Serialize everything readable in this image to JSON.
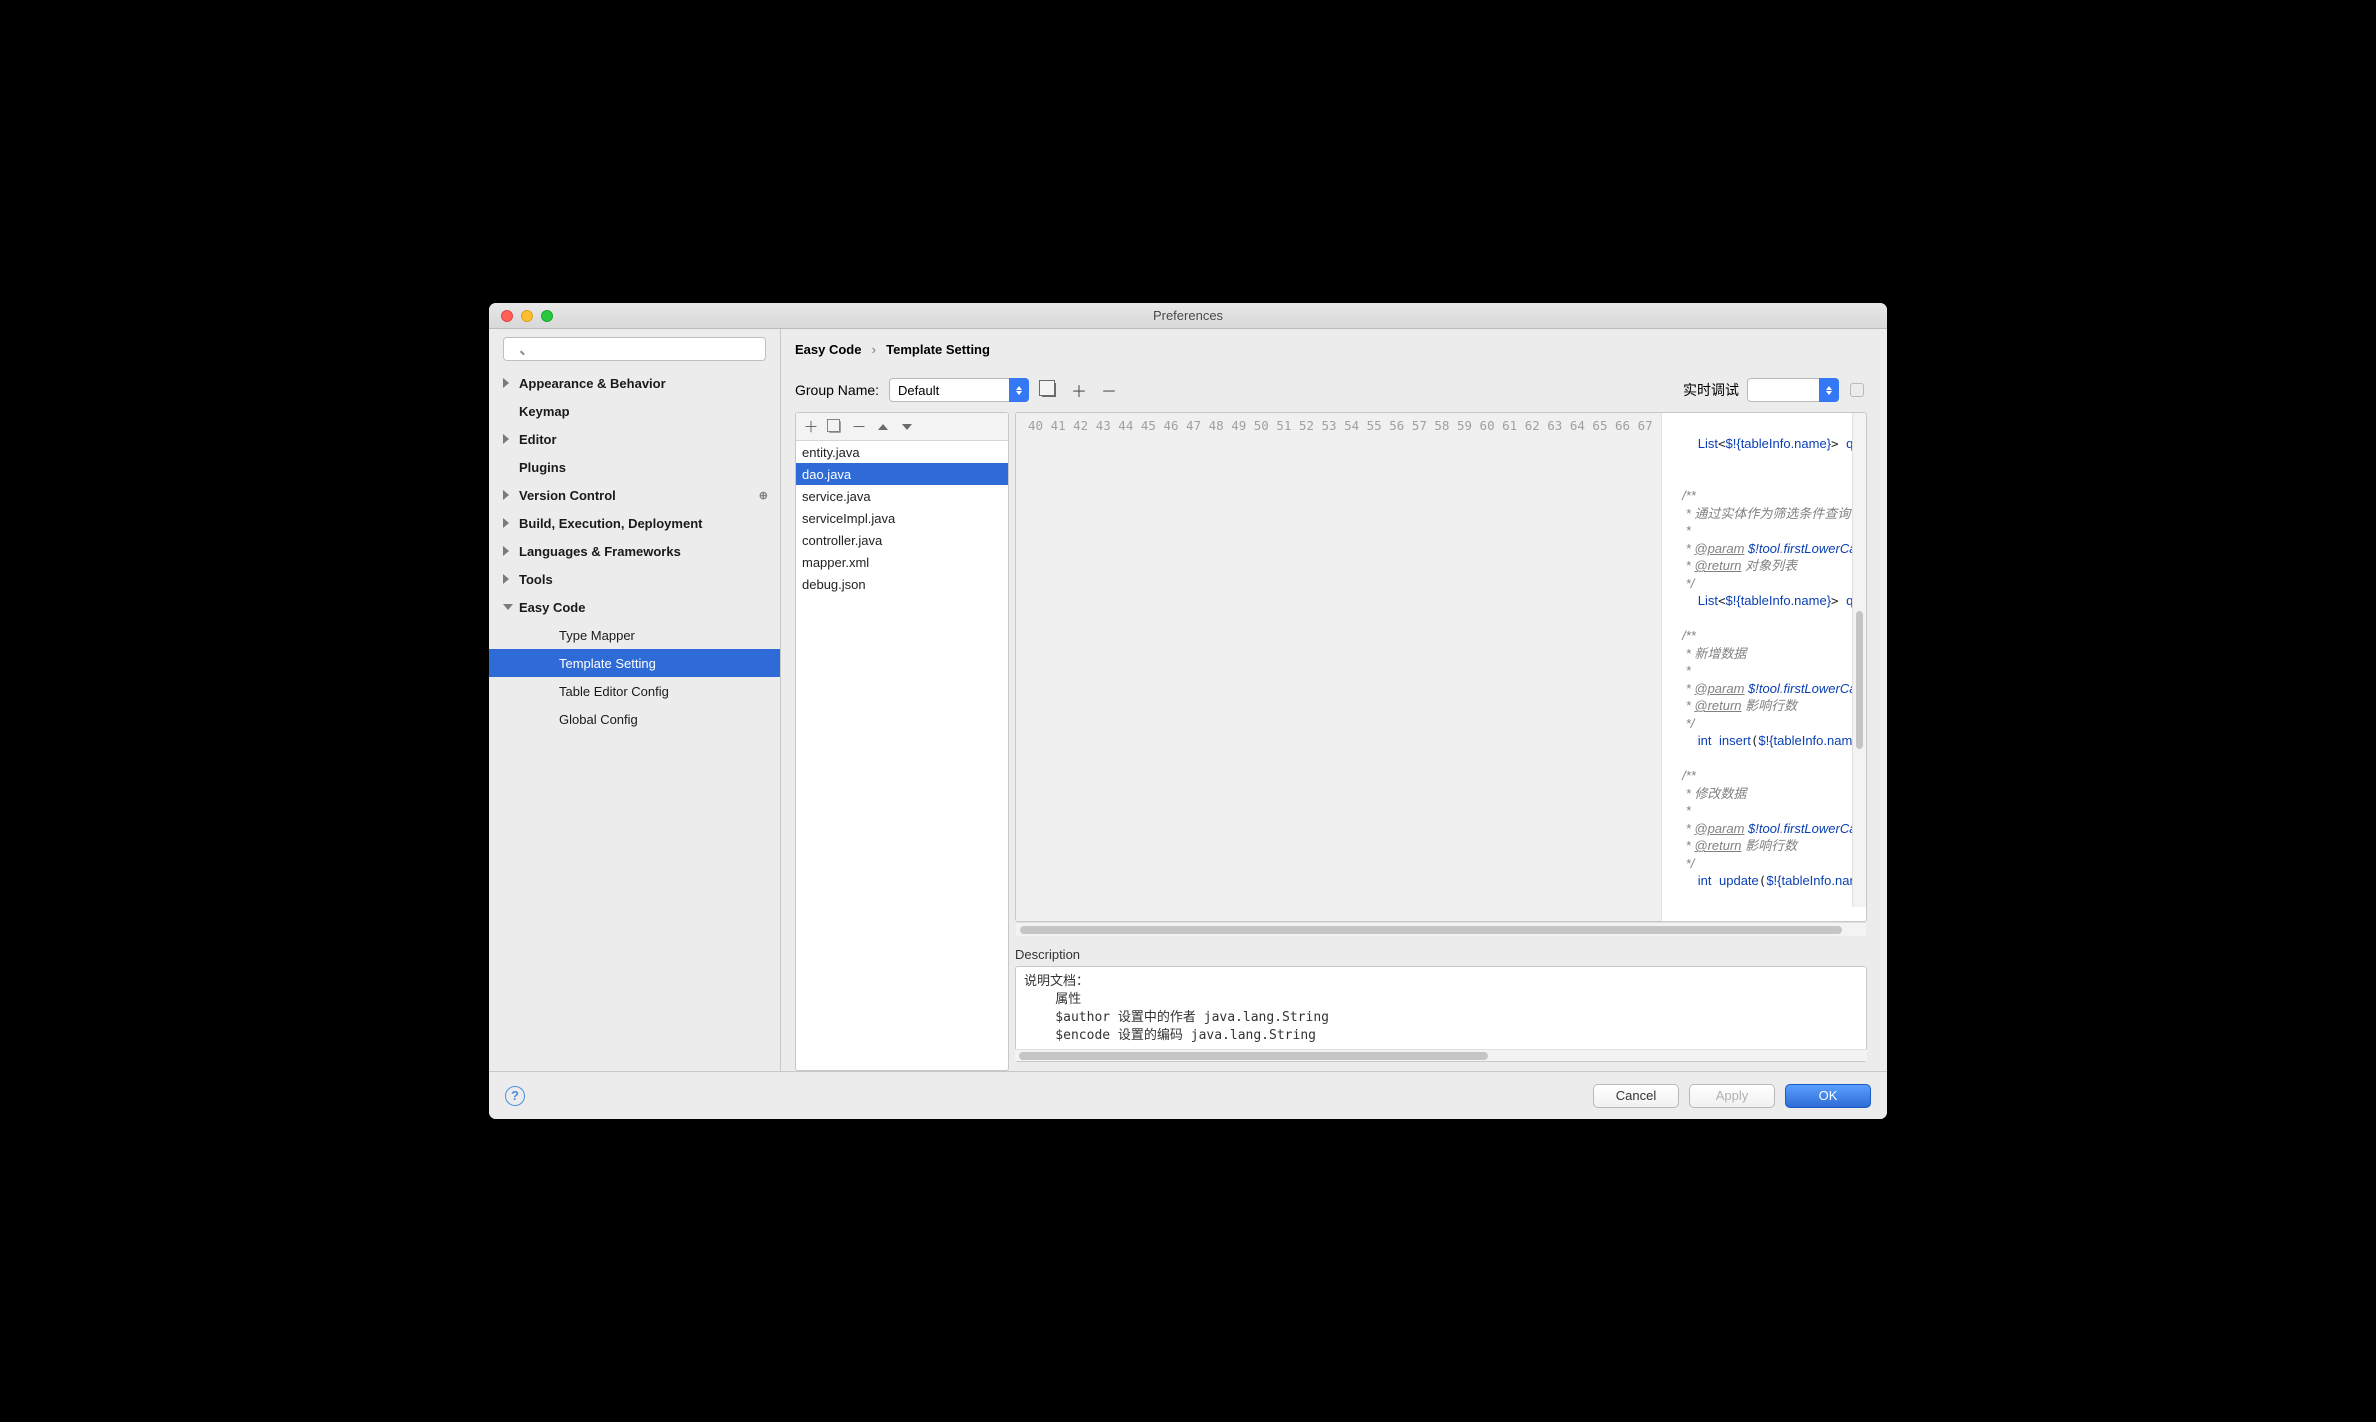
{
  "windowTitle": "Preferences",
  "search": {
    "placeholder": ""
  },
  "sidebar": {
    "items": [
      {
        "label": "Appearance & Behavior",
        "disclosure": "closed",
        "bold": true
      },
      {
        "label": "Keymap",
        "bold": true
      },
      {
        "label": "Editor",
        "disclosure": "closed",
        "bold": true
      },
      {
        "label": "Plugins",
        "bold": true
      },
      {
        "label": "Version Control",
        "disclosure": "closed",
        "bold": true,
        "badge": "⊕"
      },
      {
        "label": "Build, Execution, Deployment",
        "disclosure": "closed",
        "bold": true
      },
      {
        "label": "Languages & Frameworks",
        "disclosure": "closed",
        "bold": true
      },
      {
        "label": "Tools",
        "disclosure": "closed",
        "bold": true
      },
      {
        "label": "Easy Code",
        "disclosure": "open",
        "bold": true
      }
    ],
    "easyChildren": [
      {
        "label": "Type Mapper"
      },
      {
        "label": "Template Setting",
        "selected": true
      },
      {
        "label": "Table Editor Config"
      },
      {
        "label": "Global Config"
      }
    ]
  },
  "breadcrumb": {
    "root": "Easy Code",
    "leaf": "Template Setting"
  },
  "groupName": {
    "label": "Group Name:",
    "value": "Default"
  },
  "realtime": {
    "label": "实时调试",
    "value": ""
  },
  "files": [
    {
      "name": "entity.java"
    },
    {
      "name": "dao.java",
      "selected": true
    },
    {
      "name": "service.java"
    },
    {
      "name": "serviceImpl.java"
    },
    {
      "name": "controller.java"
    },
    {
      "name": "mapper.xml"
    },
    {
      "name": "debug.json"
    }
  ],
  "editor": {
    "startLine": 40,
    "lines": [
      "",
      "    List<$!{tableInfo.name}> queryAllByLimit(@Param(\"offset\") int offset, @Param(\"limit\") int lim",
      "",
      "",
      "    /**",
      "     * 通过实体作为筛选条件查询",
      "     *",
      "     * @param $!tool.firstLowerCase($!{tableInfo.name})  实例对象",
      "     * @return 对象列表",
      "     */",
      "    List<$!{tableInfo.name}> queryAll($!{tableInfo.name} $!tool.firstLowerCase($!{tableInfo.name}",
      "",
      "    /**",
      "     * 新增数据",
      "     *",
      "     * @param $!tool.firstLowerCase($!{tableInfo.name})  实例对象",
      "     * @return 影响行数",
      "     */",
      "    int insert($!{tableInfo.name} $!tool.firstLowerCase($!{tableInfo.name}));",
      "",
      "    /**",
      "     * 修改数据",
      "     *",
      "     * @param $!tool.firstLowerCase($!{tableInfo.name})  实例对象",
      "     * @return 影响行数",
      "     */",
      "    int update($!{tableInfo.name} $!tool.firstLowerCase($!{tableInfo.name}));",
      ""
    ]
  },
  "description": {
    "label": "Description",
    "text": "说明文档：\n    属性\n    $author 设置中的作者 java.lang.String\n    $encode 设置的编码 java.lang.String"
  },
  "buttons": {
    "cancel": "Cancel",
    "apply": "Apply",
    "ok": "OK"
  }
}
